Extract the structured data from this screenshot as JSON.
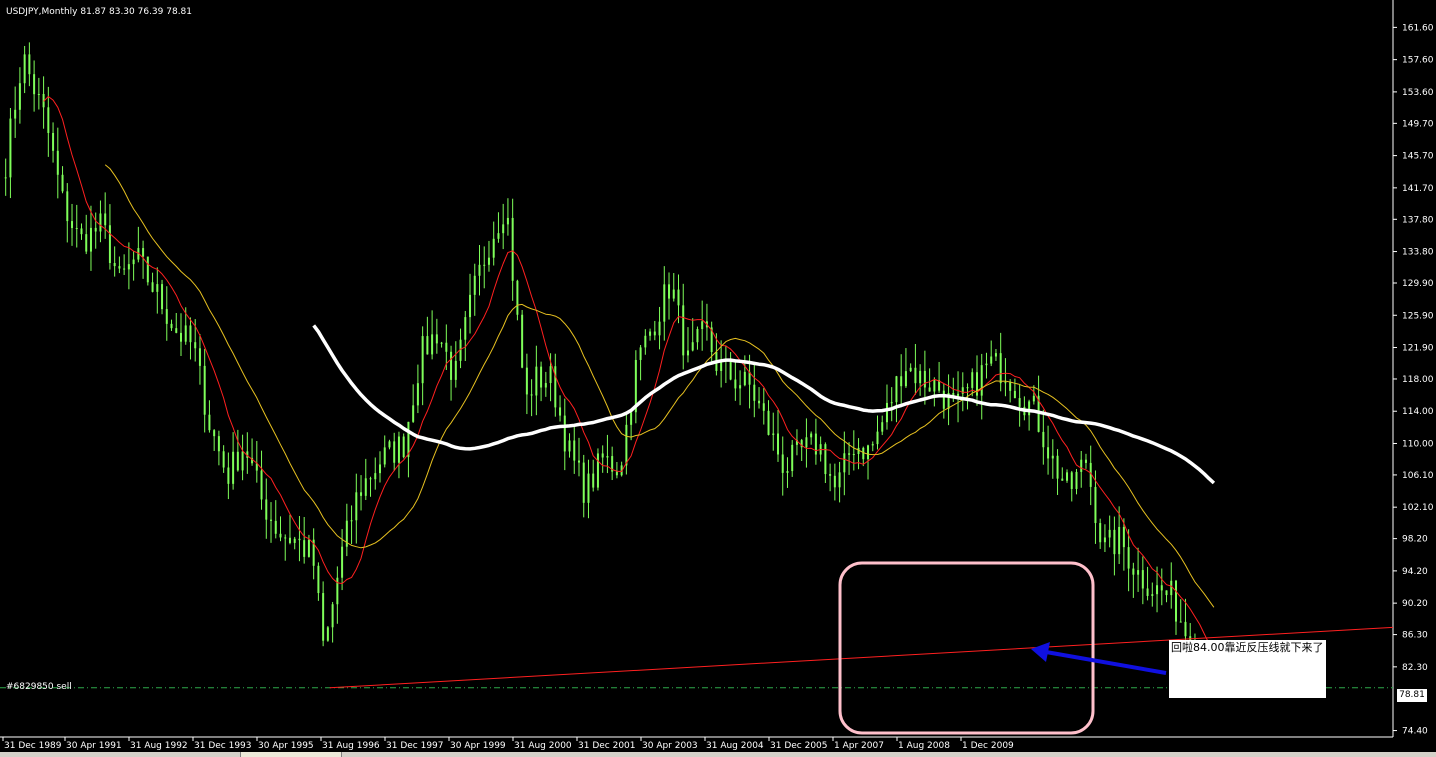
{
  "header": {
    "title": "USDJPY,Monthly  81.87 83.30 76.39 78.81"
  },
  "order_label": "#6829850 sell",
  "current_price": "78.81",
  "annotation": {
    "text": "回啦84.00靠近反压线就下来了"
  },
  "colors": {
    "background": "#000000",
    "candle": "#7fff5a",
    "ma_fast": "#ff2020",
    "ma_mid": "#e6c020",
    "ma_slow": "#ffffff",
    "trendline": "#ff2020",
    "order_line": "#2ea84a",
    "highlight_box": "#ffc0cb",
    "arrow": "#1010e0"
  },
  "chart_data": {
    "type": "line",
    "title": "USDJPY,Monthly",
    "ohlc_last": {
      "open": 81.87,
      "high": 83.3,
      "low": 76.39,
      "close": 78.81
    },
    "y_ticks": [
      "161.60",
      "157.60",
      "153.60",
      "149.70",
      "145.70",
      "141.70",
      "137.80",
      "133.80",
      "129.90",
      "125.90",
      "121.90",
      "118.00",
      "114.00",
      "110.00",
      "106.10",
      "102.10",
      "98.20",
      "94.20",
      "90.20",
      "86.30",
      "82.30",
      "74.40"
    ],
    "x_ticks": [
      "31 Dec 1989",
      "30 Apr 1991",
      "31 Aug 1992",
      "31 Dec 1993",
      "30 Apr 1995",
      "31 Aug 1996",
      "31 Dec 1997",
      "30 Apr 1999",
      "31 Aug 2000",
      "31 Dec 2001",
      "30 Apr 2003",
      "31 Aug 2004",
      "31 Dec 2005",
      "1 Apr 2007",
      "1 Aug 2008",
      "1 Dec 2009"
    ],
    "ylim": [
      73.6,
      164.5
    ],
    "x_range": [
      1989.5,
      2014.0
    ],
    "price_series": {
      "x": [
        1989.6,
        1989.9,
        1990.3,
        1990.6,
        1990.9,
        1991.3,
        1991.6,
        1991.9,
        1992.3,
        1992.6,
        1992.9,
        1993.2,
        1993.5,
        1993.8,
        1994.1,
        1994.4,
        1994.7,
        1995.0,
        1995.2,
        1995.3,
        1995.5,
        1995.8,
        1996.2,
        1996.6,
        1996.9,
        1997.2,
        1997.5,
        1997.8,
        1998.1,
        1998.4,
        1998.6,
        1998.75,
        1998.9,
        1999.2,
        1999.5,
        1999.8,
        2000.1,
        2000.4,
        2000.7,
        2001.0,
        2001.3,
        2001.6,
        2001.9,
        2002.1,
        2002.4,
        2002.7,
        2003.0,
        2003.3,
        2003.6,
        2003.9,
        2004.2,
        2004.5,
        2004.8,
        2005.1,
        2005.4,
        2005.7,
        2006.0,
        2006.3,
        2006.6,
        2006.9,
        2007.2,
        2007.45,
        2007.7,
        2008.0,
        2008.3,
        2008.6,
        2008.9,
        2009.2,
        2009.5,
        2009.8,
        2010.1,
        2010.4,
        2010.6,
        2010.9
      ],
      "close": [
        145,
        158,
        150,
        140,
        135,
        137,
        130,
        133,
        128,
        124,
        122,
        112,
        106,
        110,
        103,
        99,
        98,
        96,
        84,
        88,
        96,
        104,
        108,
        110,
        121,
        124,
        118,
        128,
        135,
        140,
        125,
        115,
        118,
        118,
        109,
        104,
        108,
        107,
        120,
        125,
        130,
        120,
        124,
        120,
        118,
        117,
        112,
        107,
        109,
        110,
        104,
        110,
        109,
        114,
        120,
        118,
        117,
        114,
        117,
        120,
        119,
        116,
        114,
        108,
        104,
        108,
        97,
        98,
        94,
        92,
        91,
        86,
        84,
        79
      ]
    },
    "trendline": {
      "from": {
        "x": 1995.3,
        "y": 79.7
      },
      "to": {
        "x": 2014.0,
        "y": 87.2
      }
    },
    "order_level": 79.7,
    "series": []
  }
}
